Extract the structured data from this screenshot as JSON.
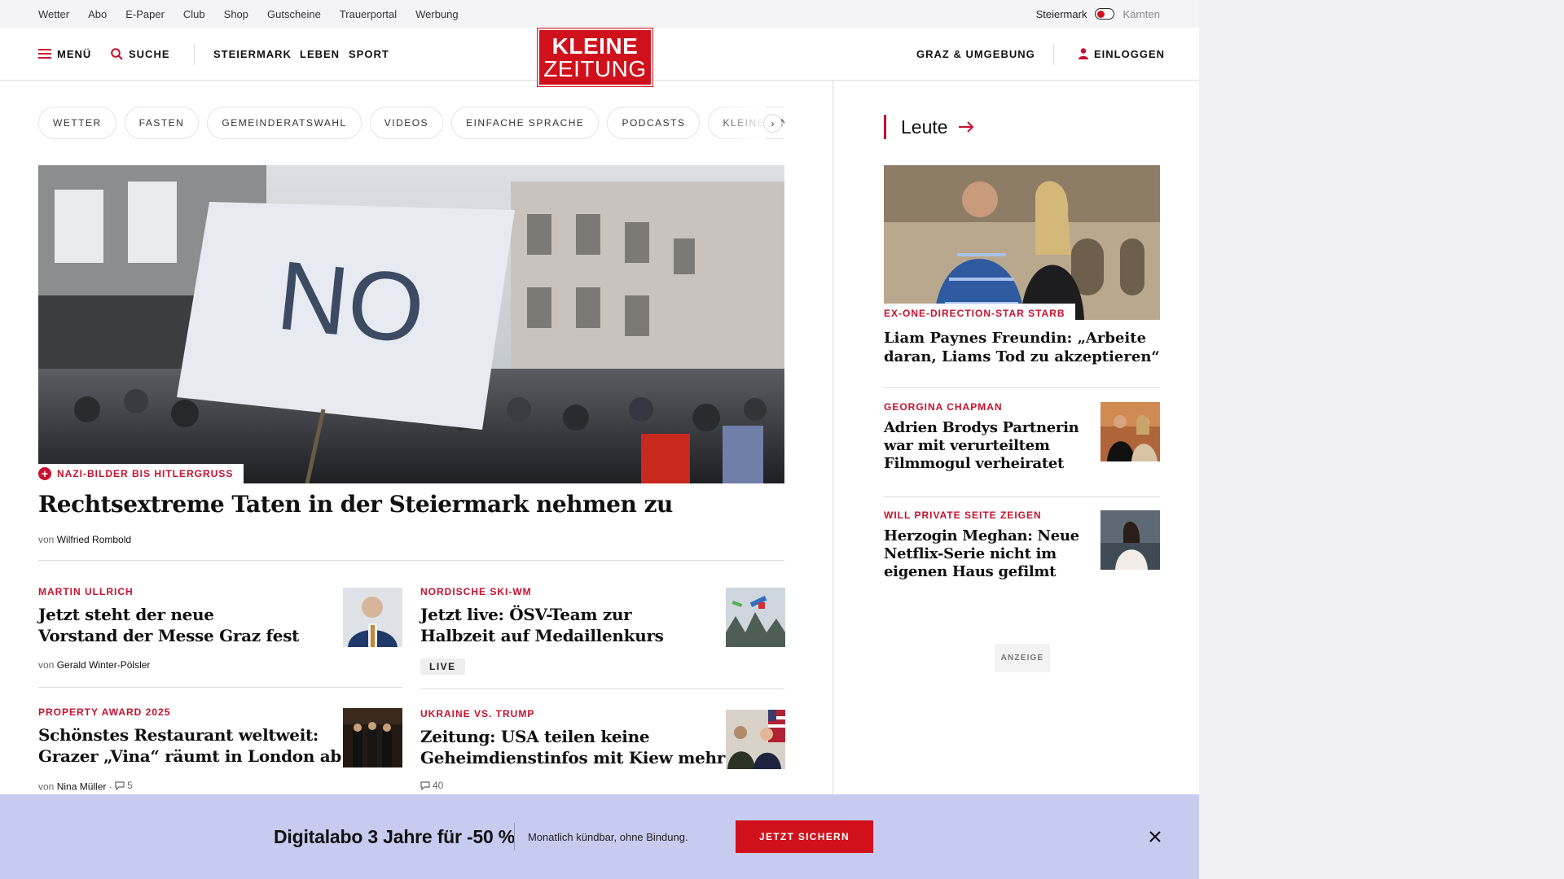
{
  "topbar": {
    "links": [
      "Wetter",
      "Abo",
      "E-Paper",
      "Club",
      "Shop",
      "Gutscheine",
      "Trauerportal",
      "Werbung"
    ],
    "region_active": "Steiermark",
    "region_inactive": "Kärnten"
  },
  "header": {
    "menu_label": "MENÜ",
    "search_label": "SUCHE",
    "nav": [
      "STEIERMARK",
      "LEBEN",
      "SPORT"
    ],
    "logo_line1": "KLEINE",
    "logo_line2": "ZEITUNG",
    "region_link": "GRAZ & UMGEBUNG",
    "login_label": "EINLOGGEN"
  },
  "chips": [
    "WETTER",
    "FASTEN",
    "GEMEINDERATSWAHL",
    "VIDEOS",
    "EINFACHE SPRACHE",
    "PODCASTS",
    "KLEINE KINDE"
  ],
  "hero": {
    "kicker": "NAZI-BILDER BIS HITLERGRUSS",
    "title": "Rechtsextreme Taten in der Steiermark nehmen zu",
    "by_prefix": "von",
    "author": "Wilfried Rombold",
    "sign_text": "NO"
  },
  "stories": [
    {
      "kicker": "MARTIN ULLRICH",
      "title_l1": "Jetzt steht der neue",
      "title_l2": "Vorstand der Messe Graz fest",
      "by_prefix": "von",
      "author": "Gerald Winter-Pölsler"
    },
    {
      "kicker": "NORDISCHE SKI-WM",
      "title_l1": "Jetzt live: ÖSV-Team zur",
      "title_l2": "Halbzeit auf Medaillenkurs",
      "badge": "LIVE"
    },
    {
      "kicker": "PROPERTY AWARD 2025",
      "title_l1": "Schönstes Restaurant weltweit:",
      "title_l2": "Grazer „Vina“ räumt in London ab",
      "by_prefix": "von",
      "author": "Nina Müller",
      "comments": "5"
    },
    {
      "kicker": "UKRAINE VS. TRUMP",
      "title_l1": "Zeitung: USA teilen keine",
      "title_l2": "Geheimdienstinfos mit Kiew mehr",
      "comments": "40"
    }
  ],
  "sidebar": {
    "section": "Leute",
    "lead_kicker": "EX-ONE-DIRECTION-STAR STARB",
    "lead_title_l1": "Liam Paynes Freundin: „Arbeite",
    "lead_title_l2": "daran, Liams Tod zu akzeptieren“",
    "items": [
      {
        "kicker": "GEORGINA CHAPMAN",
        "l1": "Adrien Brodys Partnerin",
        "l2": "war mit verurteiltem",
        "l3": "Filmmogul verheiratet"
      },
      {
        "kicker": "WILL PRIVATE SEITE ZEIGEN",
        "l1": "Herzogin Meghan: Neue",
        "l2": "Netflix-Serie nicht im",
        "l3": "eigenen Haus gefilmt"
      }
    ],
    "ad_label": "ANZEIGE"
  },
  "banner": {
    "headline": "Digitalabo 3 Jahre für -50 %",
    "sub": "Monatlich kündbar, ohne Bindung.",
    "cta": "JETZT SICHERN"
  },
  "colors": {
    "brand": "#d0111b",
    "kicker": "#c8102e",
    "banner_bg": "#c7cbf0"
  }
}
